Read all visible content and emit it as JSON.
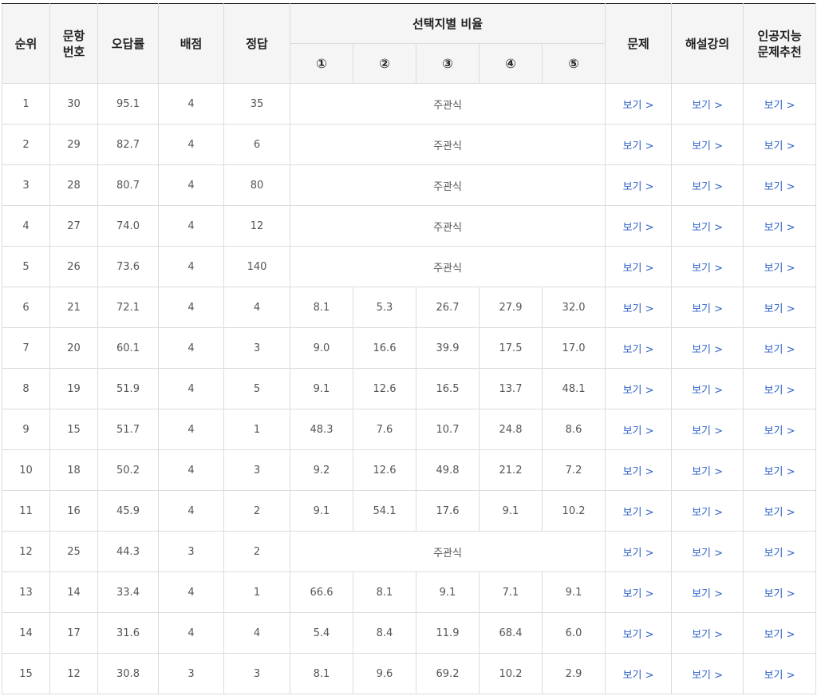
{
  "header": {
    "rank": "순위",
    "item_no_line1": "문항",
    "item_no_line2": "번호",
    "error_rate": "오답률",
    "points": "배점",
    "answer": "정답",
    "choice_ratio": "선택지별 비율",
    "choices": [
      "①",
      "②",
      "③",
      "④",
      "⑤"
    ],
    "problem": "문제",
    "lecture": "해설강의",
    "ai_line1": "인공지능",
    "ai_line2": "문제추천"
  },
  "subjective_label": "주관식",
  "view_label": "보기 >",
  "rows": [
    {
      "rank": "1",
      "no": "30",
      "rate": "95.1",
      "points": "4",
      "answer": "35",
      "choices": null
    },
    {
      "rank": "2",
      "no": "29",
      "rate": "82.7",
      "points": "4",
      "answer": "6",
      "choices": null
    },
    {
      "rank": "3",
      "no": "28",
      "rate": "80.7",
      "points": "4",
      "answer": "80",
      "choices": null
    },
    {
      "rank": "4",
      "no": "27",
      "rate": "74.0",
      "points": "4",
      "answer": "12",
      "choices": null
    },
    {
      "rank": "5",
      "no": "26",
      "rate": "73.6",
      "points": "4",
      "answer": "140",
      "choices": null
    },
    {
      "rank": "6",
      "no": "21",
      "rate": "72.1",
      "points": "4",
      "answer": "4",
      "choices": [
        "8.1",
        "5.3",
        "26.7",
        "27.9",
        "32.0"
      ]
    },
    {
      "rank": "7",
      "no": "20",
      "rate": "60.1",
      "points": "4",
      "answer": "3",
      "choices": [
        "9.0",
        "16.6",
        "39.9",
        "17.5",
        "17.0"
      ]
    },
    {
      "rank": "8",
      "no": "19",
      "rate": "51.9",
      "points": "4",
      "answer": "5",
      "choices": [
        "9.1",
        "12.6",
        "16.5",
        "13.7",
        "48.1"
      ]
    },
    {
      "rank": "9",
      "no": "15",
      "rate": "51.7",
      "points": "4",
      "answer": "1",
      "choices": [
        "48.3",
        "7.6",
        "10.7",
        "24.8",
        "8.6"
      ]
    },
    {
      "rank": "10",
      "no": "18",
      "rate": "50.2",
      "points": "4",
      "answer": "3",
      "choices": [
        "9.2",
        "12.6",
        "49.8",
        "21.2",
        "7.2"
      ]
    },
    {
      "rank": "11",
      "no": "16",
      "rate": "45.9",
      "points": "4",
      "answer": "2",
      "choices": [
        "9.1",
        "54.1",
        "17.6",
        "9.1",
        "10.2"
      ]
    },
    {
      "rank": "12",
      "no": "25",
      "rate": "44.3",
      "points": "3",
      "answer": "2",
      "choices": null
    },
    {
      "rank": "13",
      "no": "14",
      "rate": "33.4",
      "points": "4",
      "answer": "1",
      "choices": [
        "66.6",
        "8.1",
        "9.1",
        "7.1",
        "9.1"
      ]
    },
    {
      "rank": "14",
      "no": "17",
      "rate": "31.6",
      "points": "4",
      "answer": "4",
      "choices": [
        "5.4",
        "8.4",
        "11.9",
        "68.4",
        "6.0"
      ]
    },
    {
      "rank": "15",
      "no": "12",
      "rate": "30.8",
      "points": "3",
      "answer": "3",
      "choices": [
        "8.1",
        "9.6",
        "69.2",
        "10.2",
        "2.9"
      ]
    }
  ],
  "colors": {
    "link": "#2f62c8",
    "header_bg": "#f5f5f5",
    "border": "#dcdcdc",
    "top_border": "#111111"
  }
}
